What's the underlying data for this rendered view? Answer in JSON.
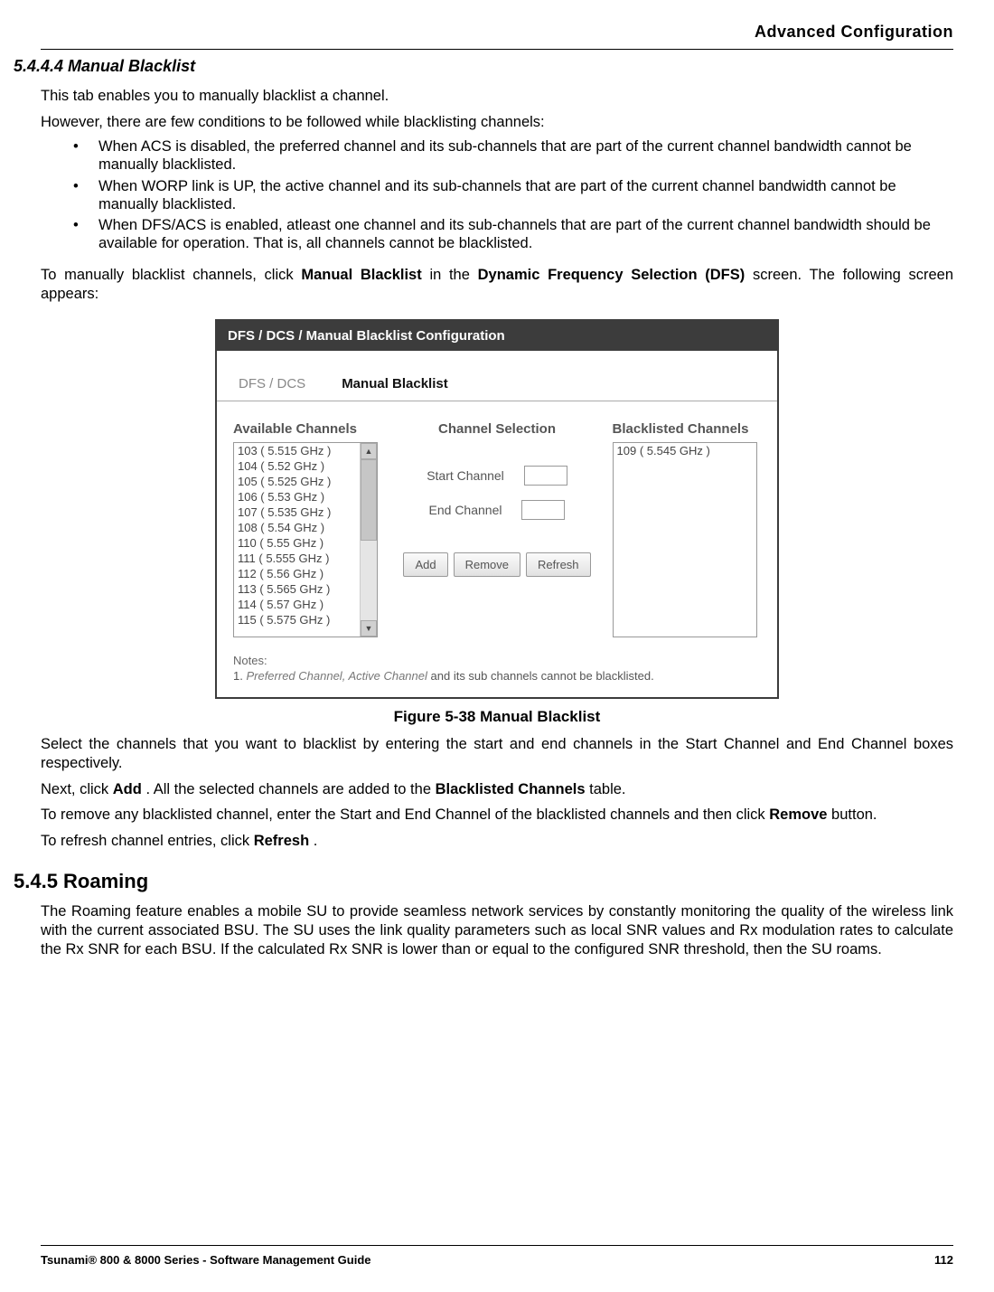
{
  "header": {
    "chapter_title": "Advanced Configuration"
  },
  "section": {
    "number_title": "5.4.4.4 Manual Blacklist",
    "intro1": "This tab enables you to manually blacklist a channel.",
    "intro2": "However, there are few conditions to be followed while blacklisting channels:",
    "conditions": [
      "When ACS is disabled, the preferred channel and its sub-channels that are part of the current channel bandwidth cannot be manually blacklisted.",
      "When WORP link is UP, the active channel and its sub-channels that are part of the current channel bandwidth cannot be manually blacklisted.",
      "When DFS/ACS is enabled, atleast one channel and its sub-channels that are part of the current channel bandwidth should be available for operation. That is, all channels cannot be blacklisted."
    ],
    "instruction_pre": "To manually blacklist channels, click ",
    "instruction_bold1": "Manual Blacklist",
    "instruction_mid1": " in the ",
    "instruction_bold2": "Dynamic Frequency Selection (DFS)",
    "instruction_post1": " screen. The following screen appears:"
  },
  "app": {
    "title": "DFS / DCS / Manual Blacklist Configuration",
    "tabs": {
      "dfs_dcs": "DFS / DCS",
      "manual_blacklist": "Manual Blacklist"
    },
    "columns": {
      "available": "Available Channels",
      "selection": "Channel Selection",
      "blacklisted": "Blacklisted Channels"
    },
    "available_channels": [
      "103 ( 5.515 GHz )",
      "104 ( 5.52 GHz )",
      "105 ( 5.525 GHz )",
      "106 ( 5.53 GHz )",
      "107 ( 5.535 GHz )",
      "108 ( 5.54 GHz )",
      "110 ( 5.55 GHz )",
      "111 ( 5.555 GHz )",
      "112 ( 5.56 GHz )",
      "113 ( 5.565 GHz )",
      "114 ( 5.57 GHz )",
      "115 ( 5.575 GHz )"
    ],
    "blacklisted_channels": [
      "109 ( 5.545 GHz )"
    ],
    "labels": {
      "start_channel": "Start Channel",
      "end_channel": "End Channel"
    },
    "buttons": {
      "add": "Add",
      "remove": "Remove",
      "refresh": "Refresh"
    },
    "notes": {
      "title": "Notes:",
      "num": "1.",
      "italic_part": "Preferred Channel, Active Channel",
      "rest": " and its sub channels cannot be blacklisted."
    }
  },
  "figure_caption": "Figure 5-38 Manual Blacklist",
  "after_text": {
    "p1": "Select the channels that you want to blacklist by entering the start and end channels in the Start Channel and End Channel boxes respectively.",
    "p2_pre": "Next, click ",
    "p2_b1": "Add",
    "p2_mid": ". All the selected channels are added to the ",
    "p2_b2": "Blacklisted Channels",
    "p2_post": " table.",
    "p3_pre": "To remove any blacklisted channel, enter the Start and End Channel of the blacklisted channels and then click ",
    "p3_b1": "Remove",
    "p3_post": " button.",
    "p4_pre": "To refresh channel entries, click ",
    "p4_b1": "Refresh",
    "p4_post": "."
  },
  "subsection": {
    "title": "5.4.5 Roaming",
    "body": "The Roaming feature enables a mobile SU to provide seamless network services by constantly monitoring the quality of the wireless link with the current associated BSU. The SU uses the link quality parameters such as local SNR values and Rx modulation rates to calculate the Rx SNR for each BSU. If the calculated Rx SNR is lower than or equal to the configured SNR threshold, then the SU roams."
  },
  "footer": {
    "left": "Tsunami® 800 & 8000 Series - Software Management Guide",
    "right": "112"
  }
}
